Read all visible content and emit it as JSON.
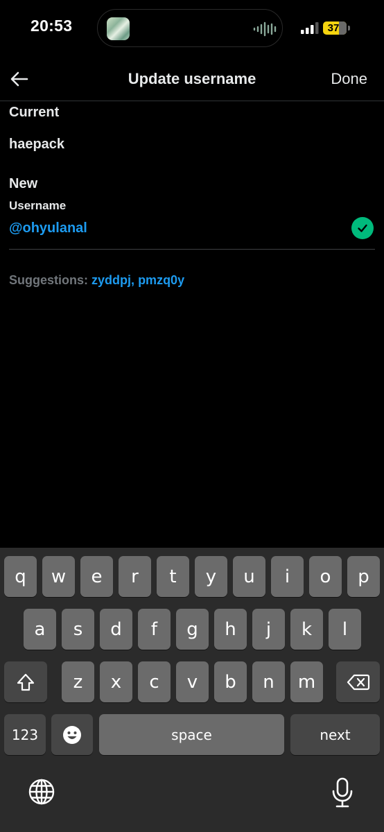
{
  "status_bar": {
    "time": "20:53",
    "battery": "37"
  },
  "header": {
    "title": "Update username",
    "done_label": "Done"
  },
  "form": {
    "current_label": "Current",
    "current_value": "haepack",
    "new_label": "New",
    "field_label": "Username",
    "field_value": "@ohyulanal",
    "suggestions_label": "Suggestions:",
    "suggestions": [
      "zyddpj",
      "pmzq0y"
    ],
    "suggestion_separator": ","
  },
  "keyboard": {
    "row1": [
      "q",
      "w",
      "e",
      "r",
      "t",
      "y",
      "u",
      "i",
      "o",
      "p"
    ],
    "row2": [
      "a",
      "s",
      "d",
      "f",
      "g",
      "h",
      "j",
      "k",
      "l"
    ],
    "row3": [
      "z",
      "x",
      "c",
      "v",
      "b",
      "n",
      "m"
    ],
    "numbers_label": "123",
    "space_label": "space",
    "next_label": "next"
  },
  "colors": {
    "accent": "#1d9bf0",
    "success": "#00ba7c",
    "background": "#000000"
  },
  "icons": [
    "back-arrow-icon",
    "checkmark-icon",
    "shift-icon",
    "backspace-icon",
    "emoji-icon",
    "globe-icon",
    "microphone-icon"
  ]
}
